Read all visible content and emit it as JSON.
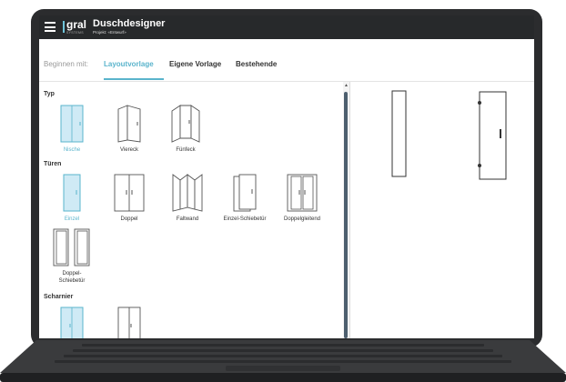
{
  "app": {
    "logo_text": "gral",
    "logo_sub": "SYSTEMS",
    "title": "Duschdesigner",
    "project": "Projekt: «Entwurf»"
  },
  "tabs": {
    "prefix": "Beginnen mit:",
    "items": [
      {
        "label": "Layoutvorlage",
        "active": true
      },
      {
        "label": "Eigene Vorlage",
        "active": false
      },
      {
        "label": "Bestehende",
        "active": false
      }
    ]
  },
  "sections": {
    "typ": {
      "label": "Typ",
      "items": [
        {
          "label": "Nische",
          "icon": "niche-shower-icon",
          "selected": true
        },
        {
          "label": "Viereck",
          "icon": "square-shower-icon",
          "selected": false
        },
        {
          "label": "Fünfeck",
          "icon": "pentagon-shower-icon",
          "selected": false
        }
      ]
    },
    "tueren": {
      "label": "Türen",
      "items": [
        {
          "label": "Einzel",
          "icon": "single-door-icon",
          "selected": true
        },
        {
          "label": "Doppel",
          "icon": "double-door-icon",
          "selected": false
        },
        {
          "label": "Faltwand",
          "icon": "folding-door-icon",
          "selected": false
        },
        {
          "label": "Einzel-Schiebetür",
          "icon": "single-sliding-door-icon",
          "selected": false
        },
        {
          "label": "Doppelgleitend",
          "icon": "double-sliding-door-icon",
          "selected": false
        },
        {
          "label": "Doppel-Schiebetür",
          "icon": "double-sliding-door-2-icon",
          "selected": false
        }
      ]
    },
    "scharnier": {
      "label": "Scharnier",
      "items": [
        {
          "label": "",
          "icon": "hinge-left-icon",
          "selected": true
        },
        {
          "label": "",
          "icon": "hinge-right-icon",
          "selected": false
        }
      ]
    }
  },
  "colors": {
    "accent": "#5ab4cc",
    "accent_fill": "#cfeaf5",
    "header": "#27292b",
    "frame": "#2b2c2e",
    "scrollbar": "#4d5f6f"
  }
}
